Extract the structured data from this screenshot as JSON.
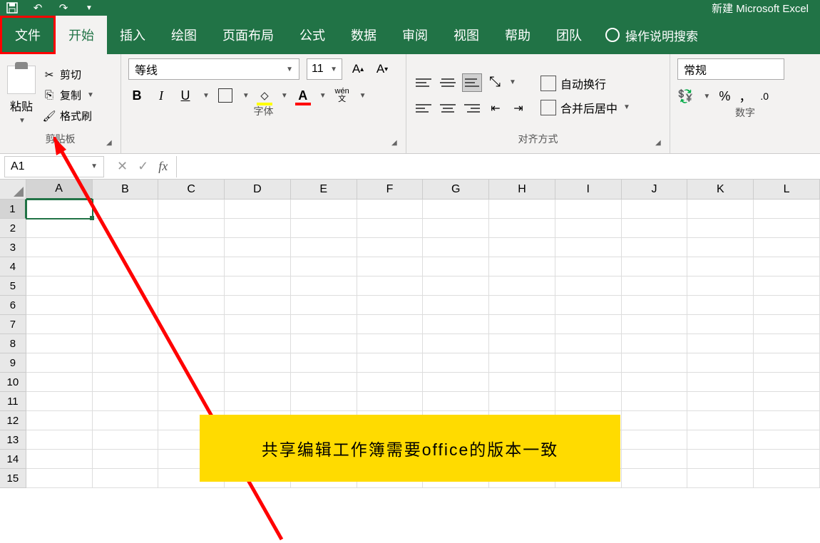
{
  "titlebar": {
    "title": "新建 Microsoft Excel"
  },
  "tabs": {
    "file": "文件",
    "home": "开始",
    "insert": "插入",
    "draw": "绘图",
    "layout": "页面布局",
    "formulas": "公式",
    "data": "数据",
    "review": "审阅",
    "view": "视图",
    "help": "帮助",
    "team": "团队",
    "search": "操作说明搜索"
  },
  "clipboard": {
    "paste": "粘贴",
    "cut": "剪切",
    "copy": "复制",
    "format_painter": "格式刷",
    "label": "剪贴板"
  },
  "font": {
    "name": "等线",
    "size": "11",
    "label": "字体",
    "color_letter": "A",
    "ruby_top": "wén",
    "ruby_bot": "文"
  },
  "alignment": {
    "wrap": "自动换行",
    "merge": "合并后居中",
    "label": "对齐方式"
  },
  "number": {
    "format": "常规",
    "label": "数字",
    "percent": "%",
    "comma": "，"
  },
  "formula_bar": {
    "cell_ref": "A1"
  },
  "columns": [
    "A",
    "B",
    "C",
    "D",
    "E",
    "F",
    "G",
    "H",
    "I",
    "J",
    "K",
    "L"
  ],
  "rows": [
    "1",
    "2",
    "3",
    "4",
    "5",
    "6",
    "7",
    "8",
    "9",
    "10",
    "11",
    "12",
    "13",
    "14",
    "15"
  ],
  "selected_cell": "A1",
  "annotation": "共享编辑工作簿需要office的版本一致"
}
